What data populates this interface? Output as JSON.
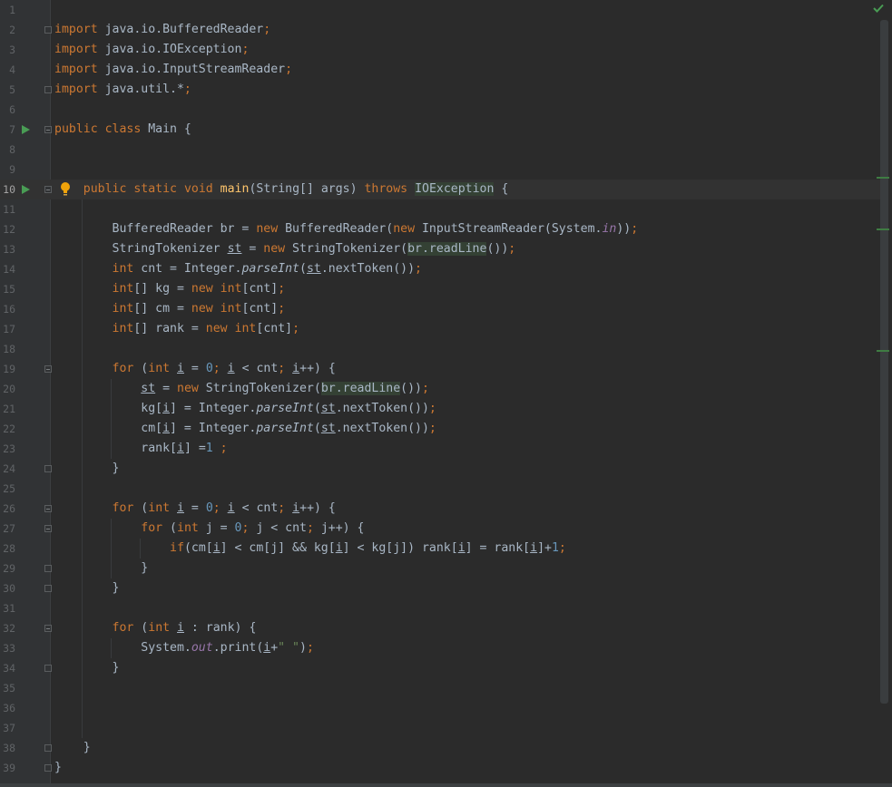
{
  "editor": {
    "status_icon": "check-icon",
    "lines": [
      {
        "n": "1",
        "text": ""
      },
      {
        "n": "2",
        "text": "import java.io.BufferedReader;"
      },
      {
        "n": "3",
        "text": "import java.io.IOException;"
      },
      {
        "n": "4",
        "text": "import java.io.InputStreamReader;"
      },
      {
        "n": "5",
        "text": "import java.util.*;"
      },
      {
        "n": "6",
        "text": ""
      },
      {
        "n": "7",
        "text": "public class Main {"
      },
      {
        "n": "8",
        "text": ""
      },
      {
        "n": "9",
        "text": ""
      },
      {
        "n": "10",
        "text": "    public static void main(String[] args) throws IOException {"
      },
      {
        "n": "11",
        "text": ""
      },
      {
        "n": "12",
        "text": "        BufferedReader br = new BufferedReader(new InputStreamReader(System.in));"
      },
      {
        "n": "13",
        "text": "        StringTokenizer st = new StringTokenizer(br.readLine());"
      },
      {
        "n": "14",
        "text": "        int cnt = Integer.parseInt(st.nextToken());"
      },
      {
        "n": "15",
        "text": "        int[] kg = new int[cnt];"
      },
      {
        "n": "16",
        "text": "        int[] cm = new int[cnt];"
      },
      {
        "n": "17",
        "text": "        int[] rank = new int[cnt];"
      },
      {
        "n": "18",
        "text": ""
      },
      {
        "n": "19",
        "text": "        for (int i = 0; i < cnt; i++) {"
      },
      {
        "n": "20",
        "text": "            st = new StringTokenizer(br.readLine());"
      },
      {
        "n": "21",
        "text": "            kg[i] = Integer.parseInt(st.nextToken());"
      },
      {
        "n": "22",
        "text": "            cm[i] = Integer.parseInt(st.nextToken());"
      },
      {
        "n": "23",
        "text": "            rank[i] =1 ;"
      },
      {
        "n": "24",
        "text": "        }"
      },
      {
        "n": "25",
        "text": ""
      },
      {
        "n": "26",
        "text": "        for (int i = 0; i < cnt; i++) {"
      },
      {
        "n": "27",
        "text": "            for (int j = 0; j < cnt; j++) {"
      },
      {
        "n": "28",
        "text": "                if(cm[i] < cm[j] && kg[i] < kg[j]) rank[i] = rank[i]+1;"
      },
      {
        "n": "29",
        "text": "            }"
      },
      {
        "n": "30",
        "text": "        }"
      },
      {
        "n": "31",
        "text": ""
      },
      {
        "n": "32",
        "text": "        for (int i : rank) {"
      },
      {
        "n": "33",
        "text": "            System.out.print(i+\" \");"
      },
      {
        "n": "34",
        "text": "        }"
      },
      {
        "n": "35",
        "text": ""
      },
      {
        "n": "36",
        "text": ""
      },
      {
        "n": "37",
        "text": ""
      },
      {
        "n": "38",
        "text": "    }"
      },
      {
        "n": "39",
        "text": "}"
      }
    ]
  },
  "colors": {
    "background": "#2b2b2b",
    "keyword": "#cc7832",
    "method": "#ffc66d",
    "number": "#6897bb",
    "string": "#6a8759",
    "static_field": "#9876aa",
    "text": "#a9b7c6"
  }
}
